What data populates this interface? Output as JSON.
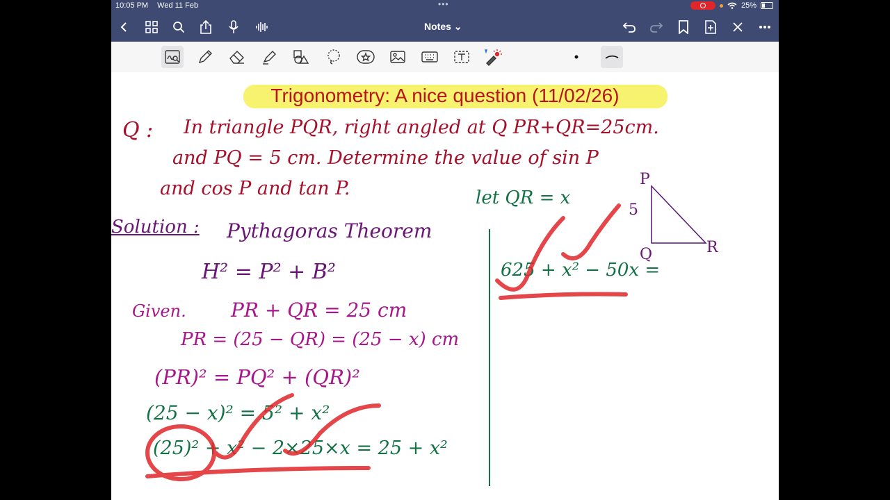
{
  "status_bar": {
    "time": "10:05 PM",
    "date": "Wed 11 Feb",
    "battery": "25%"
  },
  "nav": {
    "title": "Notes ⌄"
  },
  "icons": {
    "nav": [
      "back-icon",
      "grid-icon",
      "search-icon",
      "share-icon",
      "mic-icon",
      "waveform-icon",
      "undo-icon",
      "redo-icon",
      "bookmark-icon",
      "add-page-icon",
      "close-icon",
      "more-icon"
    ],
    "tools": [
      "handwriting-icon",
      "pen-icon",
      "eraser-icon",
      "highlighter-icon",
      "shapes-icon",
      "lasso-icon",
      "sticker-icon",
      "image-icon",
      "keyboard-icon",
      "textbox-icon",
      "laser-icon",
      "dot-size-icon",
      "stroke-icon"
    ]
  },
  "colors": {
    "bar": "#3e4a72",
    "highlight": "#f7f267",
    "title": "#b8141d",
    "question": "#a5102a",
    "solution": "#6a1477",
    "given": "#a7168b",
    "working": "#127145",
    "marks": "#e0262a"
  },
  "note": {
    "title": "Trigonometry: A nice question (11/02/26)",
    "question_label": "Q :",
    "question_line1": "In triangle PQR, right angled at Q PR+QR=25cm.",
    "question_line2": "and PQ = 5 cm. Determine the value of sin P",
    "question_line3": "and cos P and tan P.",
    "solution_label": "Solution :",
    "theorem": "Pythagoras Theorem",
    "formula": "H² = P² + B²",
    "given_label": "Given.",
    "given_eq": "PR + QR = 25 cm",
    "step1": "PR = (25 − QR) = (25 − x) cm",
    "step2": "(PR)² = PQ² + (QR)²",
    "step3": "(25 − x)² = 5² + x²",
    "step4": "(25)² + x² − 2×25×x = 25 + x²",
    "let": "let QR = x",
    "right_step": "625 + x² − 50x =",
    "triangle": {
      "p": "P",
      "q": "Q",
      "r": "R",
      "side": "5"
    }
  }
}
